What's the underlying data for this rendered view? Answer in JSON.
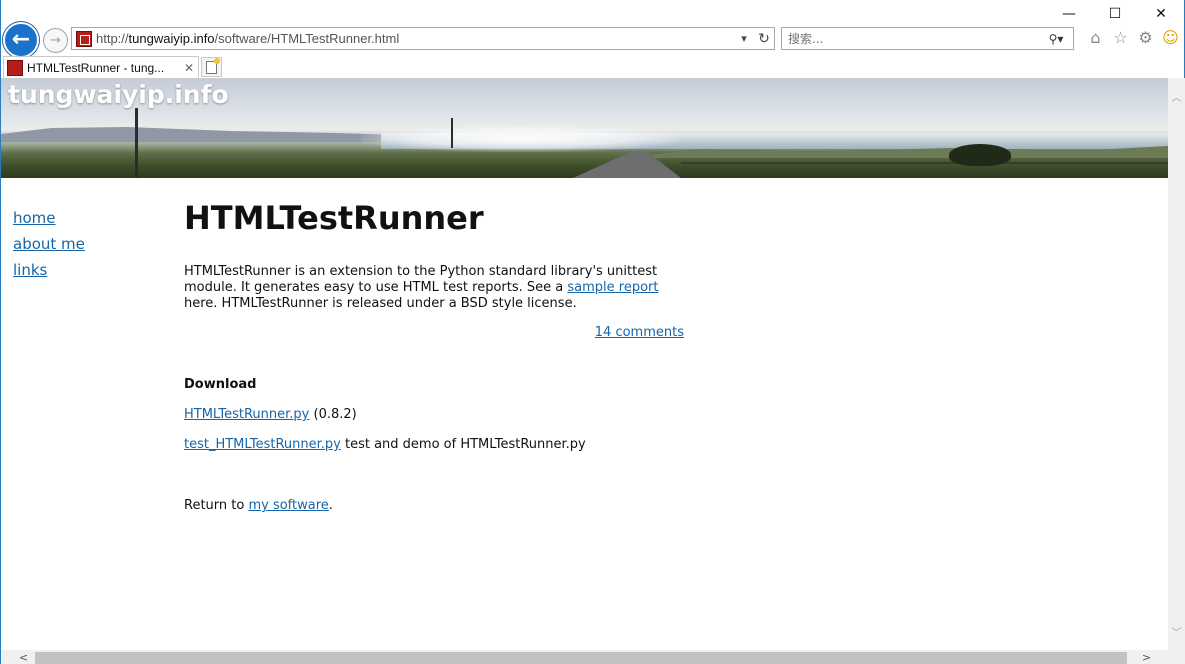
{
  "window": {
    "minimize": "—",
    "maximize": "☐",
    "close": "✕"
  },
  "toolbar": {
    "back_glyph": "←",
    "forward_glyph": "→",
    "url_prefix": "http://",
    "url_host": "tungwaiyip.info",
    "url_path": "/software/HTMLTestRunner.html",
    "address_dropdown_glyph": "▾",
    "refresh_glyph": "↻",
    "search_placeholder": "搜索...",
    "search_glyph": "⚲▾",
    "home_glyph": "⌂",
    "favorites_glyph": "☆",
    "settings_glyph": "⚙",
    "feedback_glyph": "☺"
  },
  "tab": {
    "title": "HTMLTestRunner - tung...",
    "close_glyph": "✕"
  },
  "site": {
    "title": "tungwaiyip.info"
  },
  "sidebar": {
    "items": [
      {
        "label": "home"
      },
      {
        "label": "about me"
      },
      {
        "label": "links"
      }
    ]
  },
  "content": {
    "heading": "HTMLTestRunner",
    "intro_1": "HTMLTestRunner is an extension to the Python standard library's unittest module. It generates easy to use HTML test reports. See a ",
    "intro_link": "sample report",
    "intro_2": " here. HTMLTestRunner is released under a BSD style license.",
    "comments_link": "14 comments",
    "download_heading": "Download",
    "downloads": [
      {
        "link": "HTMLTestRunner.py",
        "text": " (0.8.2)"
      },
      {
        "link": "test_HTMLTestRunner.py",
        "text": " test and demo of HTMLTestRunner.py"
      }
    ],
    "return_text": "Return to ",
    "return_link": "my software",
    "return_end": "."
  },
  "scrollbar": {
    "up": "︿",
    "down": "﹀",
    "left": "<",
    "right": ">"
  }
}
